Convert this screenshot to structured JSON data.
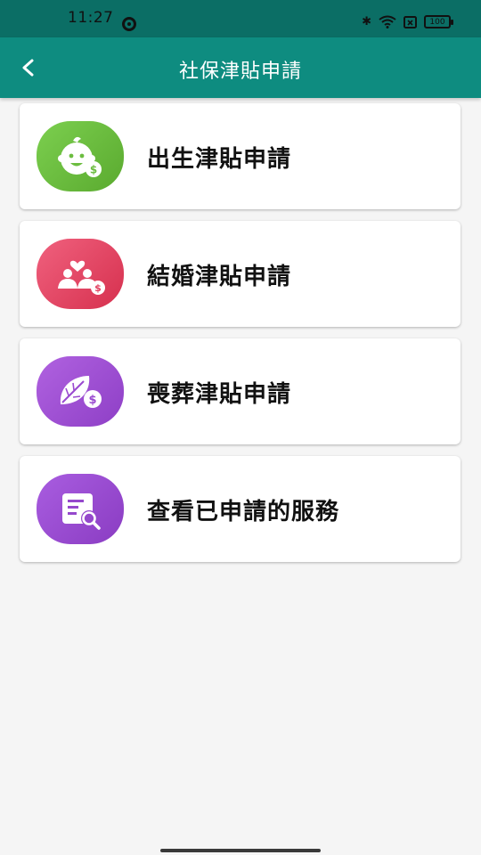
{
  "status_bar": {
    "time": "11:27",
    "battery": "100"
  },
  "app_bar": {
    "title": "社保津貼申請",
    "back_icon": "chevron-left-icon"
  },
  "menu": [
    {
      "label": "出生津貼申請",
      "icon": "baby-dollar-icon",
      "color_from": "#7ccf4f",
      "color_to": "#5aaa2f"
    },
    {
      "label": "結婚津貼申請",
      "icon": "couple-heart-dollar-icon",
      "color_from": "#f0617e",
      "color_to": "#d6304e"
    },
    {
      "label": "喪葬津貼申請",
      "icon": "leaf-dollar-icon",
      "color_from": "#b062e0",
      "color_to": "#8e3fc6"
    },
    {
      "label": "查看已申請的服務",
      "icon": "document-search-icon",
      "color_from": "#a95de0",
      "color_to": "#8a3cc2"
    }
  ]
}
